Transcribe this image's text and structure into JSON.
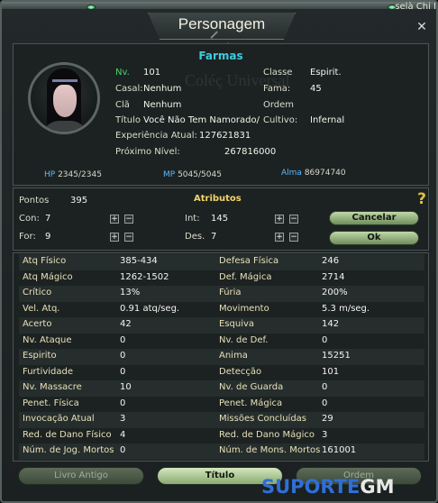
{
  "window": {
    "title": "Personagem",
    "corner_text": "selà Chi I"
  },
  "character": {
    "name": "Farmas",
    "watermark": "Coléç Universal",
    "info": [
      {
        "label": "Nv.",
        "value": "101"
      },
      {
        "label": "Casal:",
        "value": "Nenhum"
      },
      {
        "label": "Clã",
        "value": "Nenhum"
      },
      {
        "label": "Título",
        "value": "Você Não Tem Namorado/"
      },
      {
        "label": "Experiência Atual:",
        "value": "127621831"
      },
      {
        "label": "Próximo Nível:",
        "value": "267816000"
      }
    ],
    "info_right": [
      {
        "label": "Classe",
        "value": "Espirit."
      },
      {
        "label": "Fama:",
        "value": "45"
      },
      {
        "label": "Ordem",
        "value": ""
      },
      {
        "label": "Cultivo:",
        "value": "Infernal"
      }
    ],
    "hp_label": "HP",
    "hp_value": "2345/2345",
    "mp_label": "MP",
    "mp_value": "5045/5045",
    "alma_label": "Alma",
    "alma_value": "86974740"
  },
  "attributes": {
    "title": "Atributos",
    "points_label": "Pontos",
    "points_value": "395",
    "con_label": "Con:",
    "con_value": "7",
    "for_label": "For:",
    "for_value": "9",
    "int_label": "Int:",
    "int_value": "145",
    "des_label": "Des.",
    "des_value": "7",
    "plus": "+",
    "minus": "−",
    "help": "?",
    "cancel_label": "Cancelar",
    "ok_label": "Ok"
  },
  "stats": [
    {
      "l1": "Atq Físico",
      "v1": "385-434",
      "l2": "Defesa Física",
      "v2": "246"
    },
    {
      "l1": "Atq Mágico",
      "v1": "1262-1502",
      "l2": "Def. Mágica",
      "v2": "2714"
    },
    {
      "l1": "Crítico",
      "v1": "13%",
      "l2": "Fúria",
      "v2": "200%"
    },
    {
      "l1": "Vel. Atq.",
      "v1": "0.91 atq/seg.",
      "l2": "Movimento",
      "v2": "5.3 m/seg."
    },
    {
      "l1": "Acerto",
      "v1": "42",
      "l2": "Esquiva",
      "v2": "142"
    },
    {
      "l1": "Nv. Ataque",
      "v1": "0",
      "l2": "Nv. de Def.",
      "v2": "0"
    },
    {
      "l1": "Espirito",
      "v1": "0",
      "l2": "Anima",
      "v2": "15251"
    },
    {
      "l1": "Furtividade",
      "v1": "0",
      "l2": "Detecção",
      "v2": "101"
    },
    {
      "l1": "Nv. Massacre",
      "v1": "10",
      "l2": "Nv. de Guarda",
      "v2": "0"
    },
    {
      "l1": "Penet. Física",
      "v1": "0",
      "l2": "Penet. Mágica",
      "v2": "0"
    },
    {
      "l1": "Invocação Atual",
      "v1": "3",
      "l2": "Missões Concluídas",
      "v2": "29"
    },
    {
      "l1": "Red. de Dano Físico",
      "v1": "4",
      "l2": "Red. de Dano Mágico",
      "v2": "3"
    },
    {
      "l1": "Núm. de Jog. Mortos",
      "v1": "0",
      "l2": "Núm. de Mons. Mortos",
      "v2": "161001"
    }
  ],
  "tabs": {
    "livro": "Livro Antigo",
    "titulo": "Título",
    "ordem": "Ordem"
  },
  "brand": {
    "part1": "SUPORTE",
    "part2": "GM"
  }
}
